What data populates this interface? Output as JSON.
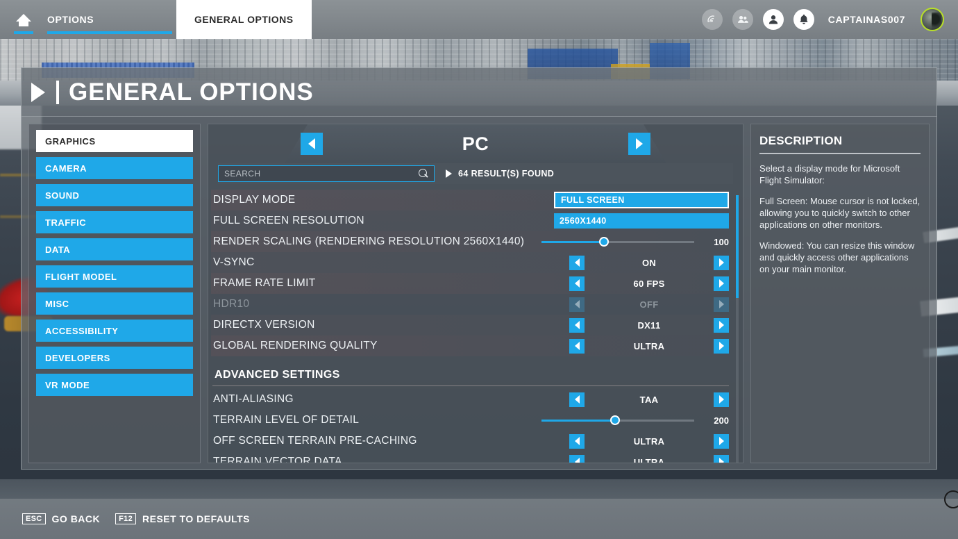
{
  "topbar": {
    "home_icon": "home-icon",
    "tab_options": "OPTIONS",
    "tab_general": "GENERAL OPTIONS",
    "icons": [
      "signal-icon",
      "friends-icon",
      "profile-icon",
      "bell-icon"
    ],
    "username": "CAPTAINAS007",
    "accent": "#1fa8e8"
  },
  "page": {
    "title": "GENERAL OPTIONS"
  },
  "sidebar": {
    "items": [
      {
        "label": "GRAPHICS",
        "active": true
      },
      {
        "label": "CAMERA",
        "active": false
      },
      {
        "label": "SOUND",
        "active": false
      },
      {
        "label": "TRAFFIC",
        "active": false
      },
      {
        "label": "DATA",
        "active": false
      },
      {
        "label": "FLIGHT MODEL",
        "active": false
      },
      {
        "label": "MISC",
        "active": false
      },
      {
        "label": "ACCESSIBILITY",
        "active": false
      },
      {
        "label": "DEVELOPERS",
        "active": false
      },
      {
        "label": "VR MODE",
        "active": false
      }
    ]
  },
  "settings": {
    "platform_title": "PC",
    "prev_label": "previous",
    "next_label": "next",
    "search": {
      "value": "",
      "placeholder": "SEARCH"
    },
    "results_text": "64 RESULT(S) FOUND",
    "rows": [
      {
        "label": "DISPLAY MODE",
        "type": "box",
        "value": "FULL SCREEN",
        "selected": true
      },
      {
        "label": "FULL SCREEN RESOLUTION",
        "type": "box",
        "value": "2560X1440",
        "selected": false
      },
      {
        "label": "RENDER SCALING (RENDERING RESOLUTION 2560X1440)",
        "type": "slider",
        "value": "100",
        "percent": 41
      },
      {
        "label": "V-SYNC",
        "type": "stepper",
        "value": "ON",
        "disabled": false
      },
      {
        "label": "FRAME RATE LIMIT",
        "type": "stepper",
        "value": "60 FPS",
        "disabled": false
      },
      {
        "label": "HDR10",
        "type": "stepper",
        "value": "OFF",
        "disabled": true
      },
      {
        "label": "DIRECTX VERSION",
        "type": "stepper",
        "value": "DX11",
        "disabled": false
      },
      {
        "label": "GLOBAL RENDERING QUALITY",
        "type": "stepper",
        "value": "ULTRA",
        "disabled": false
      }
    ],
    "section_header": "ADVANCED SETTINGS",
    "advanced_rows": [
      {
        "label": "ANTI-ALIASING",
        "type": "stepper",
        "value": "TAA",
        "disabled": false
      },
      {
        "label": "TERRAIN LEVEL OF DETAIL",
        "type": "slider",
        "value": "200",
        "percent": 48
      },
      {
        "label": "OFF SCREEN TERRAIN PRE-CACHING",
        "type": "stepper",
        "value": "ULTRA",
        "disabled": false
      },
      {
        "label": "TERRAIN VECTOR DATA",
        "type": "stepper",
        "value": "ULTRA",
        "disabled": false
      }
    ]
  },
  "description": {
    "heading": "DESCRIPTION",
    "paragraphs": [
      "Select a display mode for Microsoft Flight Simulator:",
      "Full Screen: Mouse cursor is not locked, allowing you to quickly switch to other applications on other monitors.",
      "Windowed: You can resize this window and quickly access other applications on your main monitor."
    ]
  },
  "footer": {
    "keys": [
      {
        "cap": "ESC",
        "text": "GO BACK"
      },
      {
        "cap": "F12",
        "text": "RESET TO DEFAULTS"
      }
    ]
  }
}
